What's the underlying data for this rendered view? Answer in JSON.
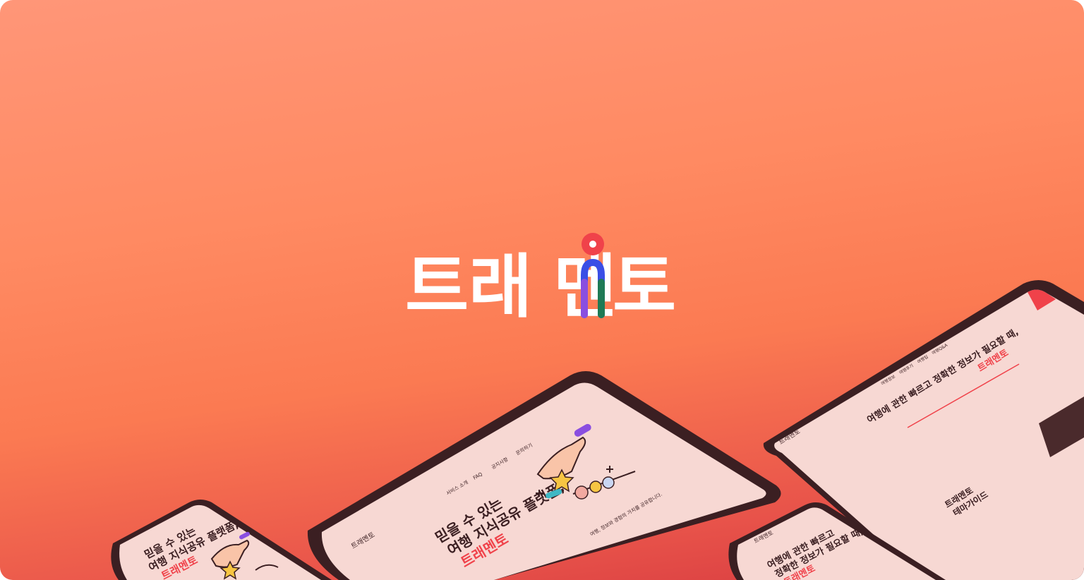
{
  "brand": {
    "name": "트래멘토",
    "part1": "트래",
    "part2": "멘",
    "part3": "토"
  },
  "colors": {
    "bg_top": "#ff9678",
    "bg_bottom": "#d6393f",
    "accent_red": "#f0424a",
    "accent_blue": "#3a4ee6",
    "accent_purple": "#8a4ee0",
    "accent_green": "#1f7a55",
    "screen_bg": "#f7d8d3",
    "device_frame": "#3b1f22"
  },
  "tablet_center": {
    "nav": [
      "서비스 소개",
      "FAQ",
      "공지사항",
      "문의하기"
    ],
    "logo": "트래멘토",
    "headline_1": "믿을 수 있는",
    "headline_2": "여행 지식공유 플랫폼,",
    "headline_3": "트래멘토",
    "sub": "여행, 정보와 경험의 가치를 공유합니다."
  },
  "tablet_right": {
    "logo": "트래멘토",
    "nav": [
      "여행정보",
      "여행후기",
      "여행팁",
      "여행Q&A"
    ],
    "headline": "여행에 관한 빠르고 정확한 정보가 필요할 때,",
    "headline_accent": "트래멘토",
    "section_title_1": "트래멘토",
    "section_title_2": "테마가이드"
  },
  "phone_left": {
    "headline_1": "믿을 수 있는",
    "headline_2": "여행 지식공유 플랫폼,",
    "headline_3": "트래멘토"
  },
  "phone_right": {
    "logo": "트래멘토",
    "headline_1": "여행에 관한 빠르고",
    "headline_2": "정확한 정보가 필요할 때,",
    "headline_3": "트래멘토"
  }
}
